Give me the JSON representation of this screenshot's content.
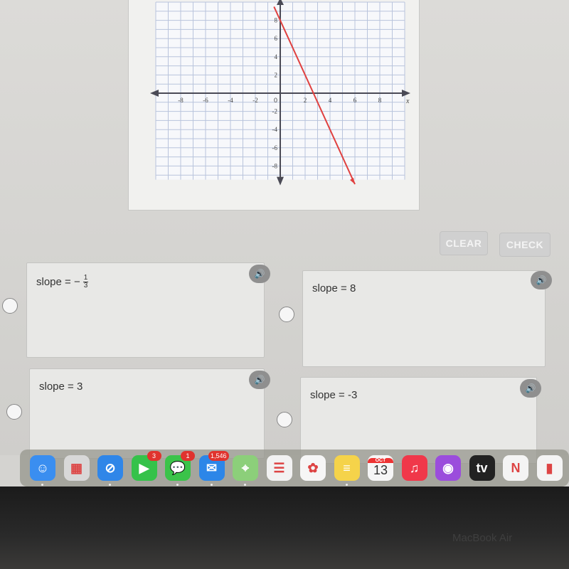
{
  "graph": {
    "x_ticks": [
      -8,
      -6,
      -4,
      -2,
      2,
      4,
      6,
      8
    ],
    "y_ticks": [
      8,
      6,
      4,
      2,
      -2,
      -4,
      -6,
      -8
    ],
    "origin_label": "0",
    "x_axis_label": "x",
    "xlim": [
      -10,
      10
    ],
    "ylim": [
      -9.5,
      10
    ],
    "line": {
      "color": "#e0403f",
      "from": [
        -0.5,
        9.5
      ],
      "to": [
        6,
        -10
      ]
    }
  },
  "buttons": {
    "clear": "CLEAR",
    "check": "CHECK"
  },
  "choices": [
    {
      "prefix": "slope = −",
      "frac_num": "1",
      "frac_den": "3",
      "label": ""
    },
    {
      "label": "slope = 8"
    },
    {
      "label": "slope = 3"
    },
    {
      "label": "slope = -3"
    }
  ],
  "speaker_icon": "🔊",
  "dock": [
    {
      "name": "finder",
      "glyph": "☺",
      "color": "#3a8ef0"
    },
    {
      "name": "launchpad",
      "glyph": "▦",
      "color": "#d8d8d8"
    },
    {
      "name": "safari",
      "glyph": "⊘",
      "color": "#2f86e8"
    },
    {
      "name": "facetime",
      "glyph": "▶",
      "color": "#35c24a",
      "badge": "3"
    },
    {
      "name": "messages",
      "glyph": "💬",
      "color": "#3bc34a",
      "badge": "1"
    },
    {
      "name": "mail",
      "glyph": "✉",
      "color": "#2c86e8",
      "badge": "1,546"
    },
    {
      "name": "maps",
      "glyph": "⌖",
      "color": "#8ccf7a"
    },
    {
      "name": "reminders",
      "glyph": "☰",
      "color": "#f2f2f2"
    },
    {
      "name": "photos",
      "glyph": "✿",
      "color": "#f6f6f6"
    },
    {
      "name": "notes",
      "glyph": "≡",
      "color": "#f5d34a"
    },
    {
      "name": "calendar",
      "month": "OCT",
      "day": "13",
      "color": "#f6f6f6"
    },
    {
      "name": "music",
      "glyph": "♫",
      "color": "#f0384a"
    },
    {
      "name": "podcasts",
      "glyph": "◉",
      "color": "#9b4ddc"
    },
    {
      "name": "tv",
      "glyph": "tv",
      "color": "#222222"
    },
    {
      "name": "news",
      "glyph": "N",
      "color": "#f4f4f4"
    },
    {
      "name": "numbers",
      "glyph": "▮",
      "color": "#f4f4f4"
    }
  ],
  "bezel_label": "MacBook Air"
}
